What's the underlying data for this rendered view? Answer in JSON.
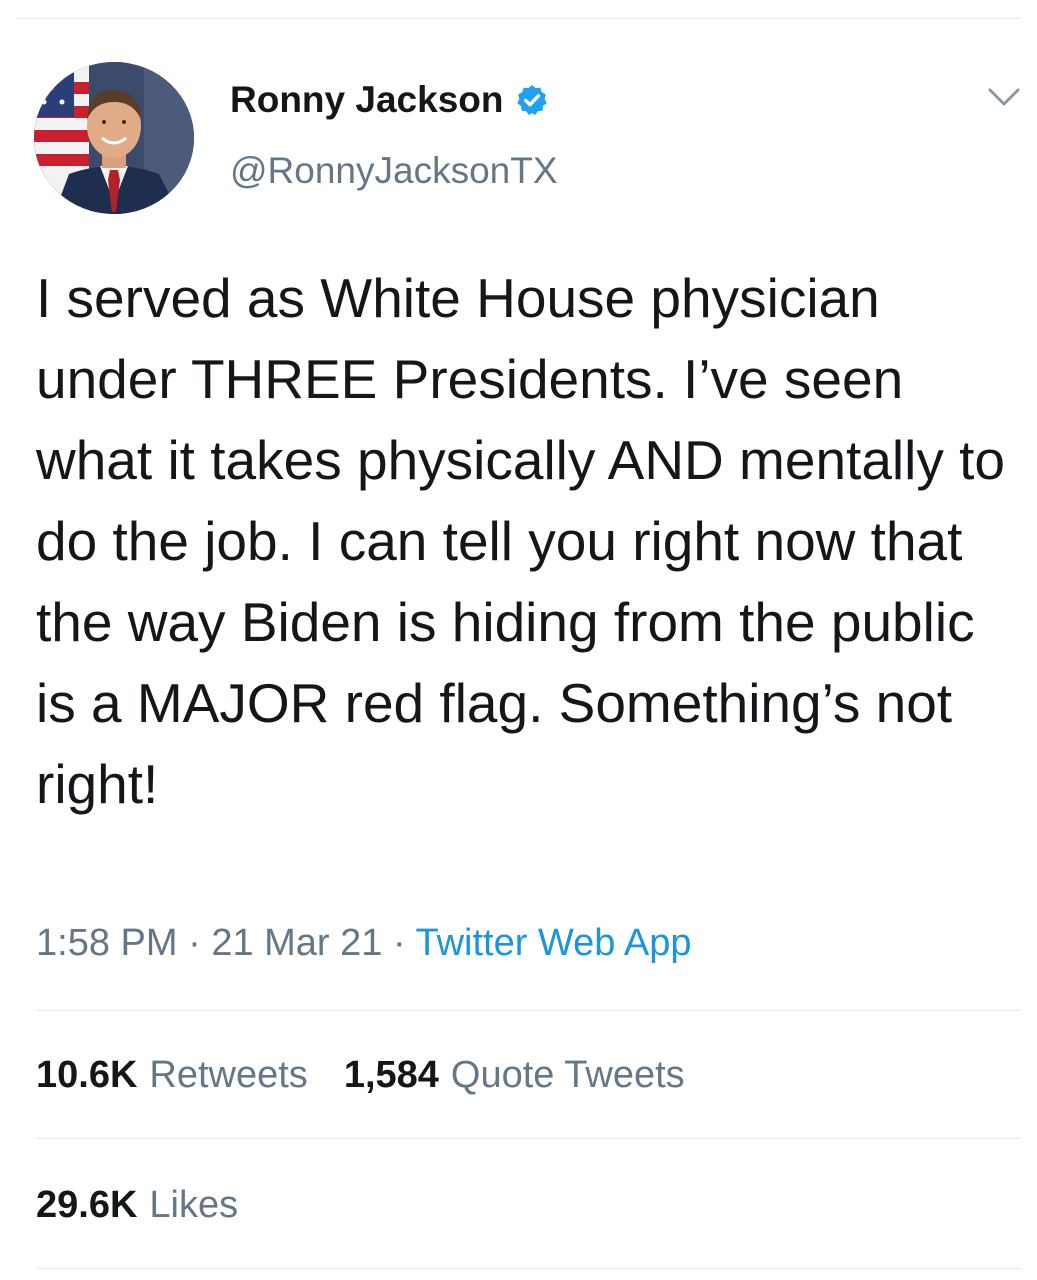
{
  "tweet": {
    "author": {
      "display_name": "Ronny Jackson",
      "handle": "@RonnyJacksonTX",
      "verified": true,
      "avatar_icon": "profile-photo"
    },
    "text": "I served as White House physician under THREE Presidents. I’ve seen what it takes physically AND mentally to do the job. I can tell you right now that the way Biden is hiding from the public is a MAJOR red flag. Something’s not right!",
    "time": "1:58 PM",
    "date": "21 Mar 21",
    "separator": "·",
    "source": "Twitter Web App",
    "stats": {
      "retweets_count": "10.6K",
      "retweets_label": "Retweets",
      "quotes_count": "1,584",
      "quotes_label": "Quote Tweets",
      "likes_count": "29.6K",
      "likes_label": "Likes"
    }
  },
  "icons": {
    "verified": "verified-badge-icon",
    "menu": "chevron-down-icon"
  },
  "colors": {
    "text_primary": "#14171a",
    "text_secondary": "#657786",
    "link": "#1b95e0",
    "verified": "#1da1f2",
    "divider": "#e6ecf0"
  }
}
